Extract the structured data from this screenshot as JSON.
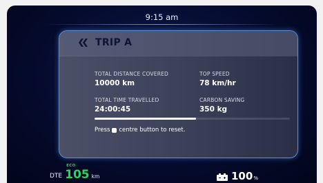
{
  "status_bar": {
    "time": "9:15 am"
  },
  "trip_card": {
    "title": "TRIP A",
    "stats": {
      "total_distance": {
        "label": "TOTAL DISTANCE COVERED",
        "value": "10000 km"
      },
      "top_speed": {
        "label": "TOP SPEED",
        "value": "78 km/hr"
      },
      "total_time": {
        "label": "TOTAL TIME TRAVELLED",
        "value": "24:00:45"
      },
      "carbon_saving": {
        "label": "CARBON SAVING",
        "value": "350 kg"
      }
    },
    "progress_percent": 52,
    "reset_hint": {
      "before": "Press",
      "after": "centre button to reset."
    }
  },
  "footer": {
    "dte": {
      "label": "DTE",
      "mode": "ECO",
      "value": "105",
      "unit": "km"
    },
    "battery": {
      "value": "100",
      "unit": "%"
    }
  },
  "colors": {
    "accent_green": "#2fd15c",
    "card_border": "#5a90d6",
    "background": "#050b2e"
  },
  "icons": {
    "back": "double-chevron-left-icon",
    "battery": "battery-icon",
    "button": "centre-button-icon"
  }
}
